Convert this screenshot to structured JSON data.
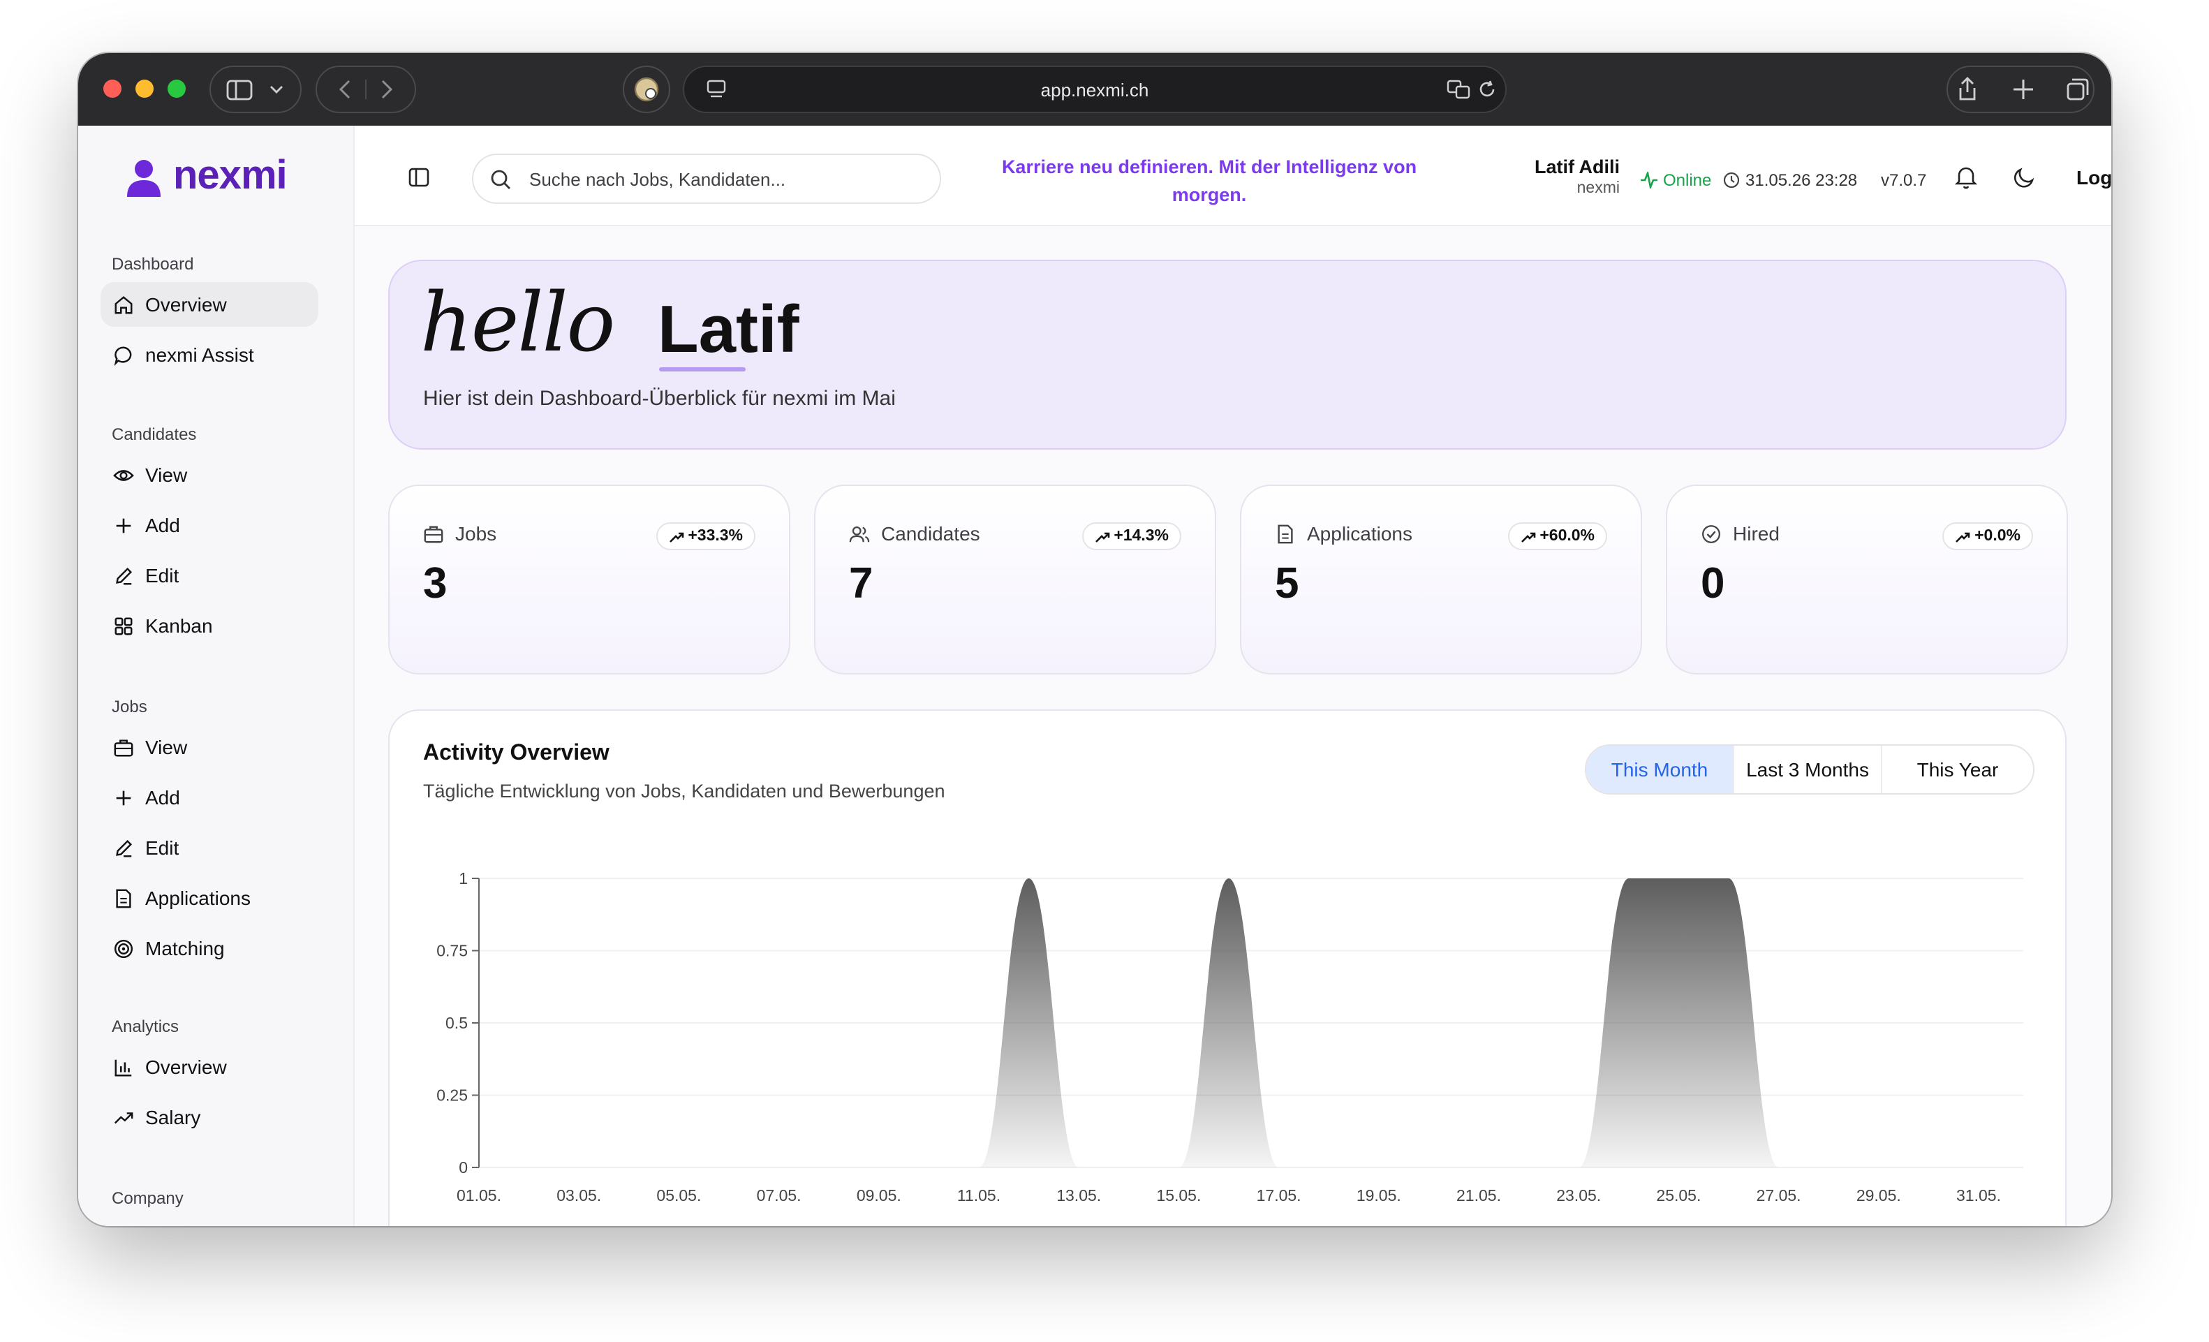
{
  "browser": {
    "url": "app.nexmi.ch"
  },
  "brand": {
    "name": "nexmi",
    "color": "#5b21b6"
  },
  "sidebar": {
    "sections": [
      {
        "title": "Dashboard",
        "items": [
          {
            "label": "Overview",
            "icon": "home-icon",
            "active": true
          },
          {
            "label": "nexmi Assist",
            "icon": "chat-bubble-icon"
          }
        ]
      },
      {
        "title": "Candidates",
        "items": [
          {
            "label": "View",
            "icon": "eye-icon"
          },
          {
            "label": "Add",
            "icon": "plus-icon"
          },
          {
            "label": "Edit",
            "icon": "pencil-icon"
          },
          {
            "label": "Kanban",
            "icon": "grid-icon"
          }
        ]
      },
      {
        "title": "Jobs",
        "items": [
          {
            "label": "View",
            "icon": "briefcase-icon"
          },
          {
            "label": "Add",
            "icon": "plus-icon"
          },
          {
            "label": "Edit",
            "icon": "pencil-icon"
          },
          {
            "label": "Applications",
            "icon": "document-icon"
          },
          {
            "label": "Matching",
            "icon": "target-icon"
          }
        ]
      },
      {
        "title": "Analytics",
        "items": [
          {
            "label": "Overview",
            "icon": "bar-chart-icon"
          },
          {
            "label": "Salary",
            "icon": "trend-up-icon"
          }
        ]
      },
      {
        "title": "Company",
        "items": []
      }
    ]
  },
  "topbar": {
    "search_placeholder": "Suche nach Jobs, Kandidaten...",
    "tagline": "Karriere neu definieren. Mit der Intelligenz von morgen.",
    "user_name": "Latif Adili",
    "user_company": "nexmi",
    "status": "Online",
    "datetime": "31.05.26 23:28",
    "version": "v7.0.7",
    "logout": "Logout"
  },
  "greeting": {
    "script_word": "hello",
    "name": "Latif",
    "subtitle": "Hier ist dein Dashboard-Überblick für nexmi im Mai"
  },
  "stats": [
    {
      "label": "Jobs",
      "value": "3",
      "change": "+33.3%",
      "icon": "briefcase-icon"
    },
    {
      "label": "Candidates",
      "value": "7",
      "change": "+14.3%",
      "icon": "users-icon"
    },
    {
      "label": "Applications",
      "value": "5",
      "change": "+60.0%",
      "icon": "document-icon"
    },
    {
      "label": "Hired",
      "value": "0",
      "change": "+0.0%",
      "icon": "check-circle-icon"
    }
  ],
  "activity": {
    "title": "Activity Overview",
    "subtitle": "Tägliche Entwicklung von Jobs, Kandidaten und Bewerbungen",
    "ranges": [
      "This Month",
      "Last 3 Months",
      "This Year"
    ],
    "active_range": "This Month",
    "active_color": "#2563eb"
  },
  "chart_data": {
    "type": "area",
    "title": "",
    "xlabel": "",
    "ylabel": "",
    "x": [
      "01.05.",
      "02.05.",
      "03.05.",
      "04.05.",
      "05.05.",
      "06.05.",
      "07.05.",
      "08.05.",
      "09.05.",
      "10.05.",
      "11.05.",
      "12.05.",
      "13.05.",
      "14.05.",
      "15.05.",
      "16.05.",
      "17.05.",
      "18.05.",
      "19.05.",
      "20.05.",
      "21.05.",
      "22.05.",
      "23.05.",
      "24.05.",
      "25.05.",
      "26.05.",
      "27.05.",
      "28.05.",
      "29.05.",
      "30.05.",
      "31.05."
    ],
    "x_tick_labels": [
      "01.05.",
      "03.05.",
      "05.05.",
      "07.05.",
      "09.05.",
      "11.05.",
      "13.05.",
      "15.05.",
      "17.05.",
      "19.05.",
      "21.05.",
      "23.05.",
      "25.05.",
      "27.05.",
      "29.05.",
      "31.05."
    ],
    "values": [
      0,
      0,
      0,
      0,
      0,
      0,
      0,
      0,
      0,
      0,
      0,
      1,
      0,
      0,
      0,
      1,
      0,
      0,
      0,
      0,
      0,
      0,
      0,
      1,
      1,
      1,
      0,
      0,
      0,
      0,
      0
    ],
    "ylim": [
      0,
      1
    ],
    "y_ticks": [
      "0",
      "0.25",
      "0.5",
      "0.75",
      "1"
    ],
    "grid": true,
    "fill_color": "#555555"
  }
}
